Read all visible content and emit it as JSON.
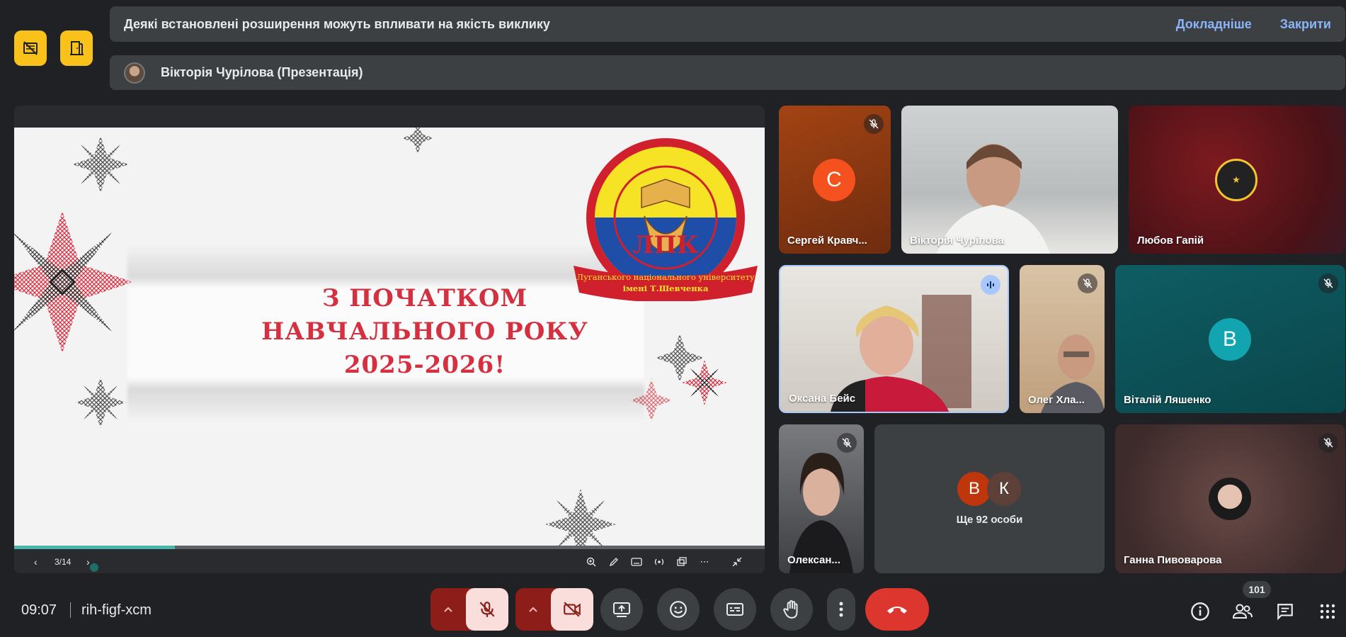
{
  "notice": {
    "text": "Деякі встановлені розширення можуть впливати на якість виклику",
    "learn_more": "Докладніше",
    "close": "Закрити"
  },
  "presenter_bar": {
    "text": "Вікторія Чурілова (Презентація)"
  },
  "slide": {
    "title_line1": "З ПОЧАТКОМ",
    "title_line2": "НАВЧАЛЬНОГО РОКУ",
    "title_line3": "2025-2026!",
    "logo_letters": "ЛПК",
    "logo_ribbon_line1": "Луганського національного університету",
    "logo_ribbon_line2": "імені Т.Шевченка",
    "page": "3/14",
    "progress": 0.214
  },
  "participants": [
    {
      "name": "Сергей Кравч...",
      "initial": "С",
      "muted": true,
      "avatar_color": "#f4511e"
    },
    {
      "name": "Вікторія Чурілова",
      "muted": false
    },
    {
      "name": "Любов Гапій",
      "muted": false
    },
    {
      "name": "Оксана Бейс",
      "speaking": true
    },
    {
      "name": "Олег Хла...",
      "muted": true
    },
    {
      "name": "Віталій Ляшенко",
      "initial": "В",
      "muted": true,
      "avatar_color": "#12a4af"
    },
    {
      "name": "Олексан...",
      "muted": true
    },
    {
      "name": "Ще 92 особи",
      "initials": [
        "В",
        "К"
      ],
      "avatar_colors": [
        "#bf360c",
        "#5d4037"
      ]
    },
    {
      "name": "Ганна Пивоварова",
      "muted": true
    }
  ],
  "bottom_bar": {
    "time": "09:07",
    "meeting_code": "rih-figf-xcm",
    "people_count": "101"
  },
  "colors": {
    "accent_yellow": "#f9c21b",
    "end_call": "#dc362e",
    "link": "#8ab4f8",
    "progress": "#4db6ac"
  }
}
